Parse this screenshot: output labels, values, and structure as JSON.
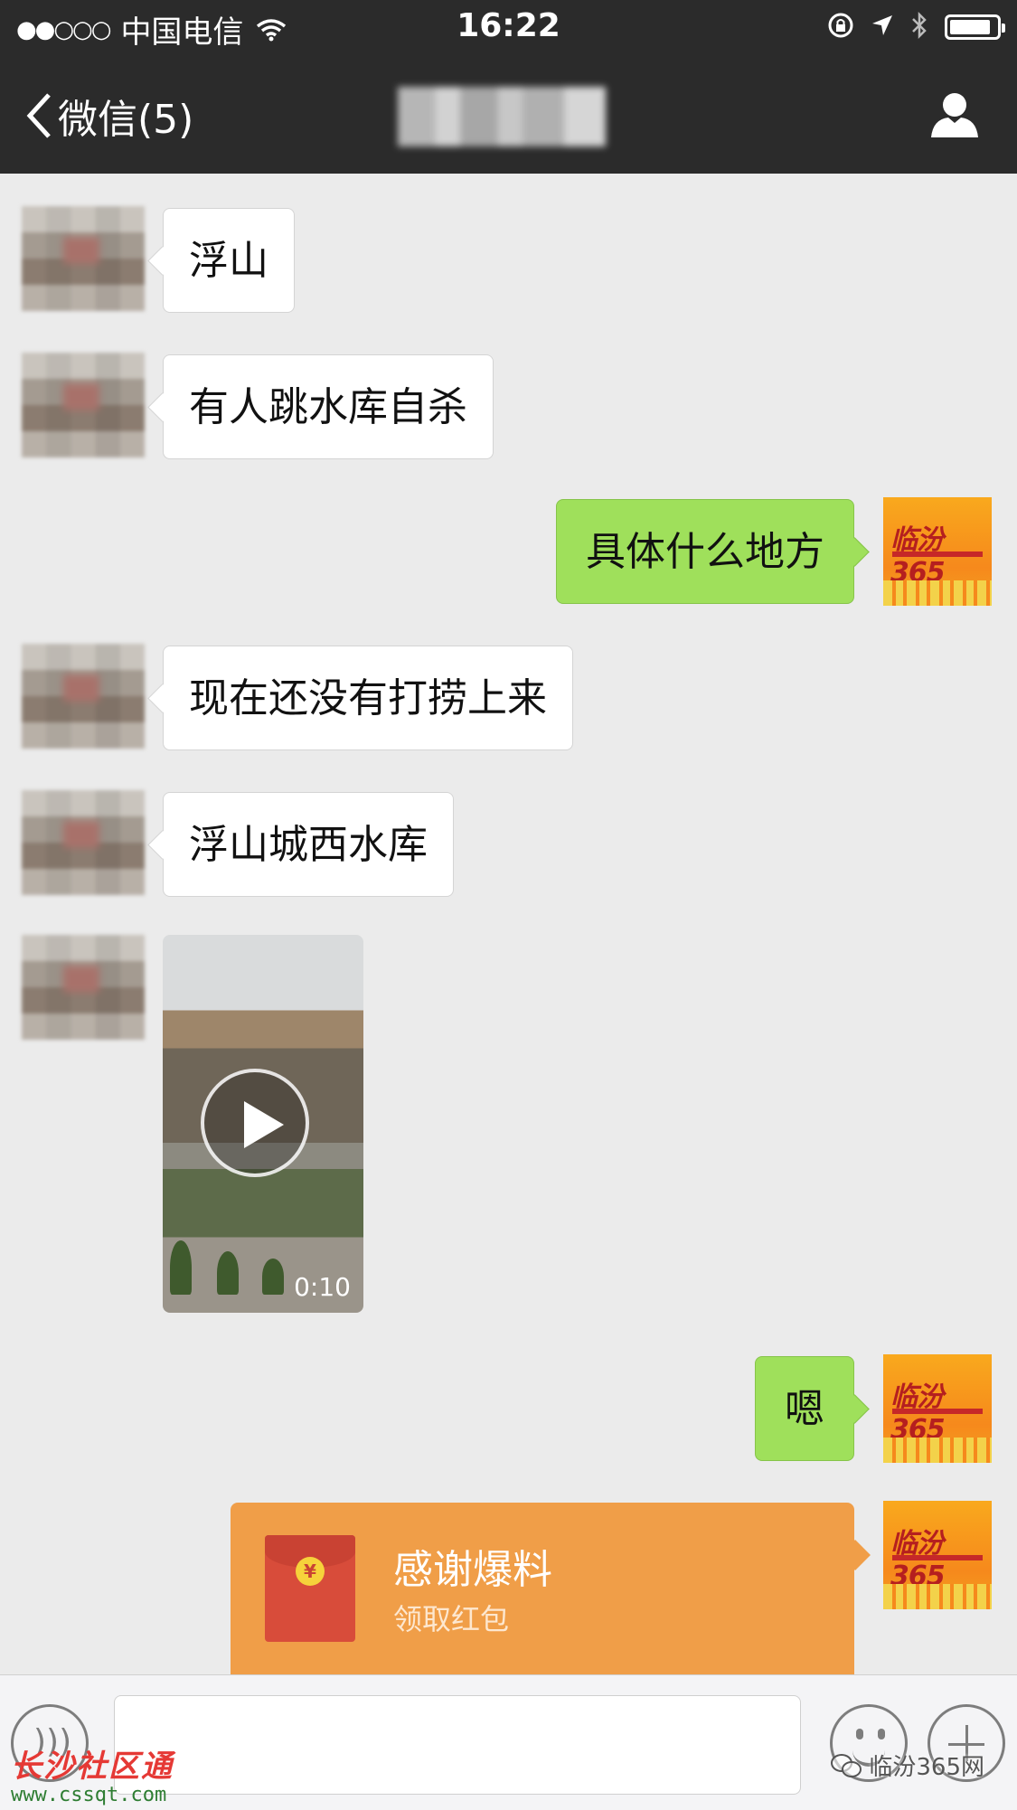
{
  "status_bar": {
    "signal": "●●○○○",
    "carrier": "中国电信",
    "time": "16:22"
  },
  "nav": {
    "back_label": "微信(5)",
    "title": ""
  },
  "messages": [
    {
      "from": "contact",
      "type": "text",
      "text": "浮山"
    },
    {
      "from": "contact",
      "type": "text",
      "text": "有人跳水库自杀"
    },
    {
      "from": "me",
      "type": "text",
      "text": "具体什么地方"
    },
    {
      "from": "contact",
      "type": "text",
      "text": "现在还没有打捞上来"
    },
    {
      "from": "contact",
      "type": "text",
      "text": "浮山城西水库"
    },
    {
      "from": "contact",
      "type": "video",
      "duration": "0:10"
    },
    {
      "from": "me",
      "type": "text",
      "text": "嗯"
    },
    {
      "from": "me",
      "type": "red_packet",
      "title": "感谢爆料",
      "subtitle": "领取红包",
      "coin": "¥"
    }
  ],
  "my_avatar": {
    "brand": "临汾365"
  },
  "watermarks": {
    "left_title": "长沙社区通",
    "left_url": "www.cssqt.com",
    "right": "临汾365网"
  },
  "colors": {
    "nav_bg": "#2b2b2b",
    "chat_bg": "#ebebeb",
    "bubble_out": "#9fe05b",
    "red_packet": "#f09e48"
  },
  "icons": [
    "wifi-icon",
    "lock-rotation-icon",
    "location-arrow-icon",
    "bluetooth-icon",
    "battery-icon",
    "back-chevron-icon",
    "person-icon",
    "play-icon",
    "voice-icon",
    "emoji-icon",
    "plus-icon",
    "wechat-icon"
  ]
}
